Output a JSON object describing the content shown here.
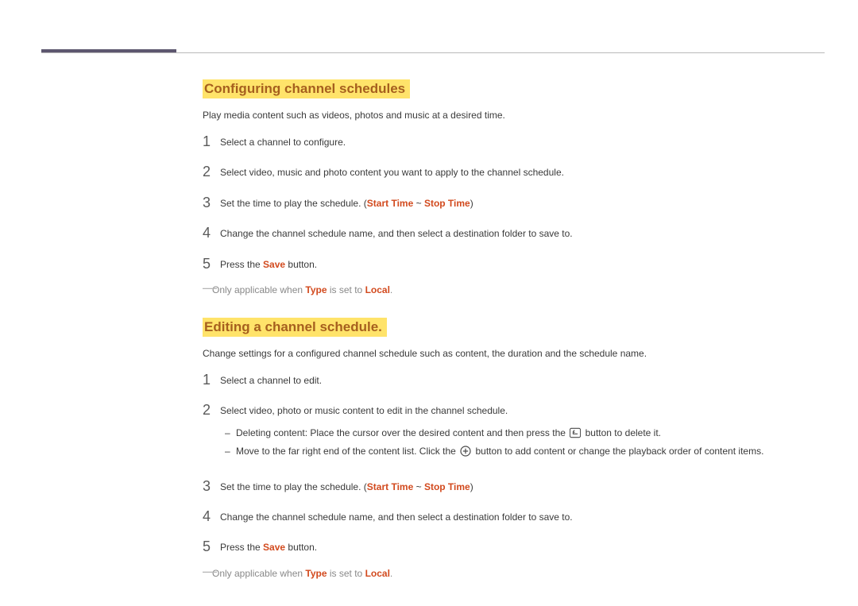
{
  "section1": {
    "title": "Configuring channel schedules",
    "intro": "Play media content such as videos, photos and music at a desired time.",
    "steps": {
      "s1": "Select a channel to configure.",
      "s2": "Select video, music and photo content you want to apply to the channel schedule.",
      "s3_a": "Set the time to play the schedule. (",
      "s3_b": "Start Time",
      "s3_c": " ~ ",
      "s3_d": "Stop Time",
      "s3_e": ")",
      "s4": "Change the channel schedule name, and then select a destination folder to save to.",
      "s5_a": "Press the ",
      "s5_b": "Save",
      "s5_c": " button."
    },
    "note": {
      "a": "Only applicable when ",
      "b": "Type",
      "c": " is set to ",
      "d": "Local",
      "e": "."
    }
  },
  "section2": {
    "title": "Editing a channel schedule.",
    "intro": "Change settings for a configured channel schedule such as content, the duration and the schedule name.",
    "steps": {
      "s1": "Select a channel to edit.",
      "s2": "Select video, photo or music content to edit in the channel schedule.",
      "s2sub": {
        "a1": "Deleting content: Place the cursor over the desired content and then press the ",
        "a2": " button to delete it.",
        "b1": "Move to the far right end of the content list. Click the ",
        "b2": " button to add content or change the playback order of content items."
      },
      "s3_a": "Set the time to play the schedule. (",
      "s3_b": "Start Time",
      "s3_c": " ~ ",
      "s3_d": "Stop Time",
      "s3_e": ")",
      "s4": "Change the channel schedule name, and then select a destination folder to save to.",
      "s5_a": "Press the ",
      "s5_b": "Save",
      "s5_c": " button."
    },
    "note": {
      "a": "Only applicable when ",
      "b": "Type",
      "c": " is set to ",
      "d": "Local",
      "e": "."
    }
  }
}
